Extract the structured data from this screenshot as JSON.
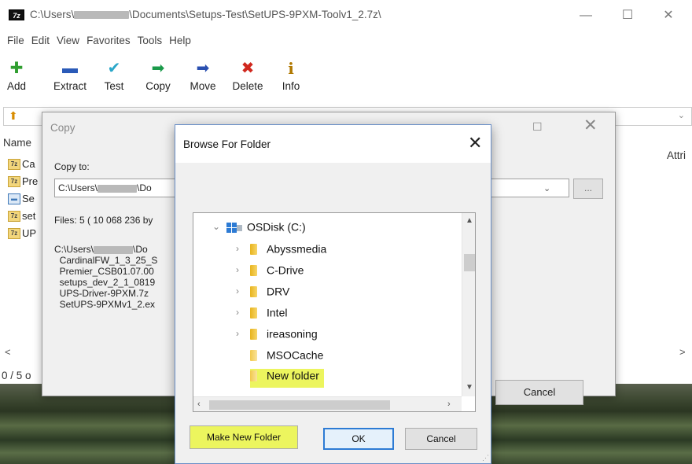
{
  "window": {
    "title_prefix": "C:\\Users\\",
    "title_suffix": "\\Documents\\Setups-Test\\SetUPS-9PXM-Toolv1_2.7z\\",
    "logo": "7z",
    "minimize_glyph": "—",
    "maximize_glyph": "☐",
    "close_glyph": "✕"
  },
  "menu": [
    "File",
    "Edit",
    "View",
    "Favorites",
    "Tools",
    "Help"
  ],
  "toolbar": [
    {
      "label": "Add",
      "icon": "✚",
      "color": "#2f9e2f"
    },
    {
      "label": "Extract",
      "icon": "▬",
      "color": "#2a5ab8"
    },
    {
      "label": "Test",
      "icon": "✔",
      "color": "#2aa7c9"
    },
    {
      "label": "Copy",
      "icon": "➡",
      "color": "#1a9a4a"
    },
    {
      "label": "Move",
      "icon": "➡",
      "color": "#2a4fb0"
    },
    {
      "label": "Delete",
      "icon": "✖",
      "color": "#d0281e"
    },
    {
      "label": "Info",
      "icon": "i",
      "color": "#b07800"
    }
  ],
  "list": {
    "col_name": "Name",
    "col_attri": "Attri",
    "rows": [
      "Ca",
      "Pre",
      "Se",
      "set",
      "UP"
    ],
    "scroll_left": "<",
    "scroll_right": ">"
  },
  "status": "0 / 5 o",
  "copy_dialog": {
    "title": "Copy",
    "copy_to_label": "Copy to:",
    "path_prefix": "C:\\Users\\",
    "path_suffix": "\\Do",
    "browse_label": "...",
    "files_text": "Files: 5   ( 10 068 236 by",
    "info_prefix": "C:\\Users\\",
    "info_suffix": "\\Do",
    "files": [
      "CardinalFW_1_3_25_S",
      "Premier_CSB01.07.00",
      "setups_dev_2_1_0819",
      "UPS-Driver-9PXM.7z",
      "SetUPS-9PXMv1_2.ex"
    ],
    "cancel": "Cancel",
    "restore_glyph": "☐",
    "close_glyph": "✕"
  },
  "browse_dialog": {
    "title": "Browse For Folder",
    "close_glyph": "✕",
    "drive": "OSDisk (C:)",
    "folders": [
      "Abyssmedia",
      "C-Drive",
      "DRV",
      "Intel",
      "ireasoning",
      "MSOCache",
      "New folder"
    ],
    "make_new_folder": "Make New Folder",
    "ok": "OK",
    "cancel": "Cancel",
    "highlight_color": "#ecf55e"
  }
}
